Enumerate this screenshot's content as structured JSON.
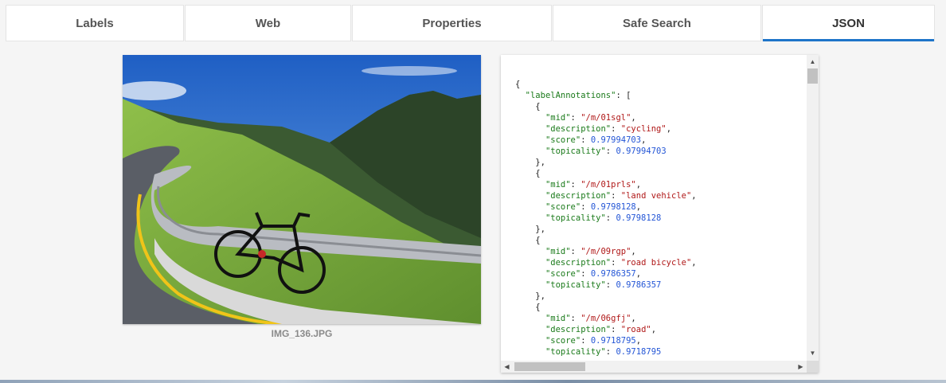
{
  "tabs": [
    {
      "label": "Labels"
    },
    {
      "label": "Web"
    },
    {
      "label": "Properties"
    },
    {
      "label": "Safe Search"
    },
    {
      "label": "JSON"
    }
  ],
  "active_tab": "JSON",
  "accent_color": "#1e74c9",
  "image": {
    "caption": "IMG_136.JPG",
    "description_icon": "photo-image"
  },
  "json_view": {
    "root_key": "labelAnnotations",
    "annotations": [
      {
        "mid": "/m/01sgl",
        "description": "cycling",
        "score": "0.97994703",
        "topicality": "0.97994703"
      },
      {
        "mid": "/m/01prls",
        "description": "land vehicle",
        "score": "0.9798128",
        "topicality": "0.9798128"
      },
      {
        "mid": "/m/09rgp",
        "description": "road bicycle",
        "score": "0.9786357",
        "topicality": "0.9786357"
      },
      {
        "mid": "/m/06gfj",
        "description": "road",
        "score": "0.9718795",
        "topicality": "0.9718795"
      }
    ],
    "colors": {
      "key": "#1a7a1a",
      "string": "#b01818",
      "number": "#2456d6"
    }
  },
  "scrollbars": {
    "up_arrow": "▲",
    "down_arrow": "▼",
    "left_arrow": "◀",
    "right_arrow": "▶"
  }
}
